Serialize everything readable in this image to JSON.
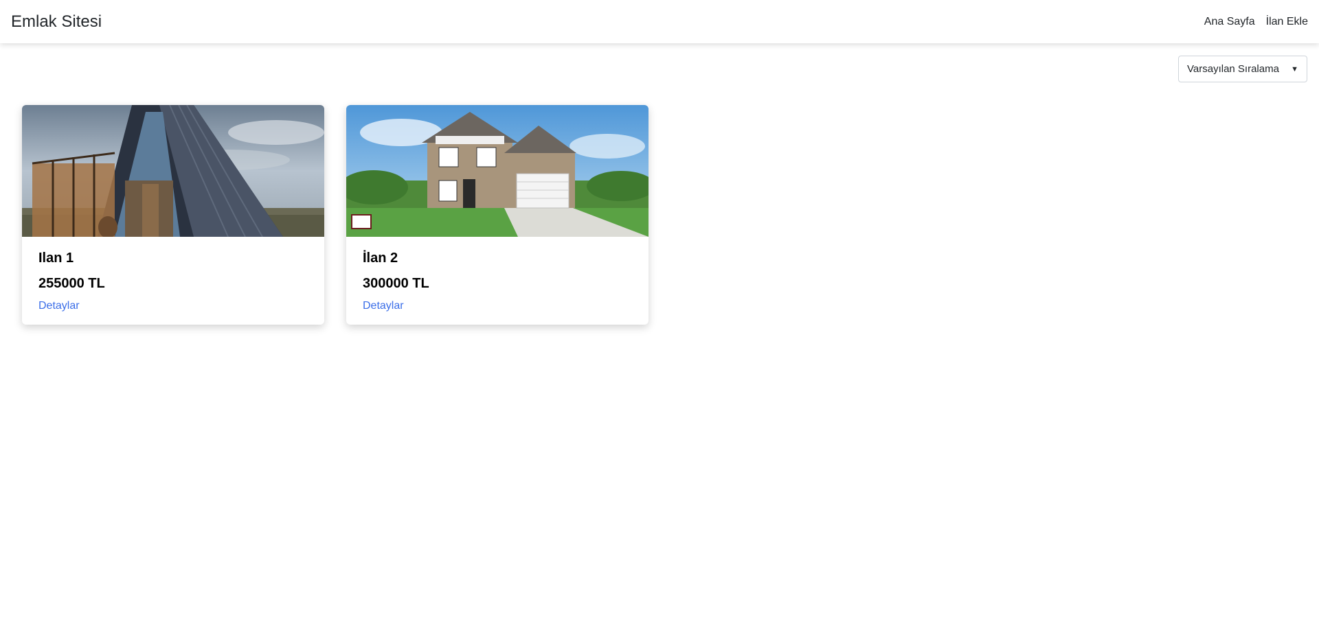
{
  "navbar": {
    "brand": "Emlak Sitesi",
    "links": [
      {
        "label": "Ana Sayfa"
      },
      {
        "label": "İlan Ekle"
      }
    ]
  },
  "sort": {
    "selected": "Varsayılan Sıralama"
  },
  "listings": [
    {
      "title": "Ilan 1",
      "price": "255000 TL",
      "link": "Detaylar",
      "image": "a-frame-cabin-photo"
    },
    {
      "title": "İlan 2",
      "price": "300000 TL",
      "link": "Detaylar",
      "image": "two-story-house-photo"
    }
  ],
  "colors": {
    "link": "#3b6ee8",
    "text": "#212529"
  }
}
